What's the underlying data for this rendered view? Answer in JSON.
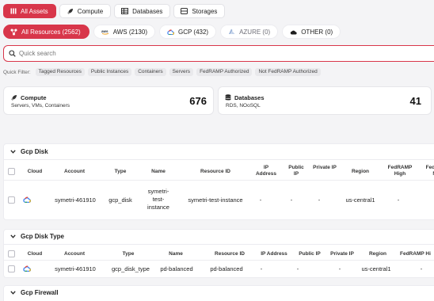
{
  "top_tabs": [
    {
      "label": "All Assets",
      "icon": "grid-icon",
      "active": true
    },
    {
      "label": "Compute",
      "icon": "rocket-icon"
    },
    {
      "label": "Databases",
      "icon": "table-icon"
    },
    {
      "label": "Storages",
      "icon": "storage-icon"
    }
  ],
  "cloud_filters": [
    {
      "label": "All Resources (2562)",
      "icon": "nodes-icon",
      "active": true
    },
    {
      "label": "AWS (2130)",
      "icon": "aws-icon"
    },
    {
      "label": "GCP (432)",
      "icon": "gcp-icon"
    },
    {
      "label": "AZURE (0)",
      "icon": "azure-icon",
      "muted": true
    },
    {
      "label": "OTHER (0)",
      "icon": "cloud-icon"
    }
  ],
  "search": {
    "placeholder": "Quick search"
  },
  "quick_filter": {
    "label": "Quick Filter:",
    "chips": [
      "Tagged Resources",
      "Public Instances",
      "Containers",
      "Servers",
      "FedRAMP Authorized",
      "Not FedRAMP Authorized"
    ]
  },
  "summary": {
    "compute": {
      "title": "Compute",
      "subtitle": "Servers, VMs, Containers",
      "count": "676"
    },
    "databases": {
      "title": "Databases",
      "subtitle": "RDS, NOoSQL",
      "count": "41"
    }
  },
  "sections": {
    "gcp_disk": {
      "title": "Gcp Disk",
      "headers": [
        "Cloud",
        "Account",
        "Type",
        "Name",
        "Resource ID",
        "IP Address",
        "Public IP",
        "Private IP",
        "Region",
        "FedRAMP High",
        "FedRAMP Mod"
      ],
      "row": {
        "account": "symetri-461910",
        "type": "gcp_disk",
        "name": "symetri-test-instance",
        "resource_id": "symetri-test-instance",
        "ip": "-",
        "public_ip": "-",
        "private_ip": "-",
        "region": "us-central1",
        "fedramp_high": "-"
      }
    },
    "gcp_disk_type": {
      "title": "Gcp Disk Type",
      "headers": [
        "Cloud",
        "Account",
        "Type",
        "Name",
        "Resource ID",
        "IP Address",
        "Public IP",
        "Private IP",
        "Region",
        "FedRAMP Hi"
      ],
      "row": {
        "account": "symetri-461910",
        "type": "gcp_disk_type",
        "name": "pd-balanced",
        "resource_id": "pd-balanced",
        "ip": "-",
        "public_ip": "-",
        "private_ip": "-",
        "region": "us-central1",
        "fedramp_high": "-"
      }
    },
    "gcp_firewall": {
      "title": "Gcp Firewall"
    }
  },
  "colors": {
    "accent": "#d8364a",
    "background": "#f4f4f6"
  }
}
